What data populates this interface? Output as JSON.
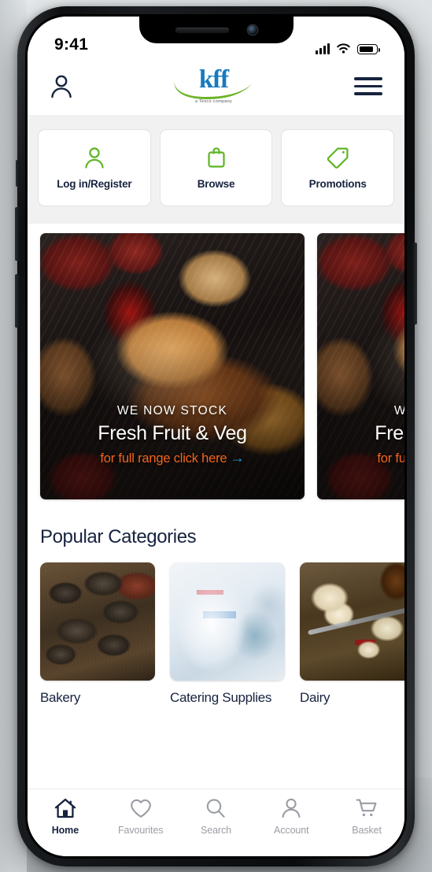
{
  "status_bar": {
    "time": "9:41",
    "signal_icon": "cellular-signal-icon",
    "wifi_icon": "wifi-icon",
    "battery_icon": "battery-icon"
  },
  "header": {
    "account_icon": "person-icon",
    "logo_text": "kff",
    "logo_tagline": "a Tesco company",
    "menu_icon": "hamburger-menu-icon",
    "logo_blue": "#1879bf",
    "logo_green": "#6cb427"
  },
  "quick_actions": [
    {
      "label": "Log in/Register",
      "icon": "person-icon"
    },
    {
      "label": "Browse",
      "icon": "shopping-bag-icon"
    },
    {
      "label": "Promotions",
      "icon": "tag-icon"
    }
  ],
  "banner": {
    "slides": [
      {
        "kicker": "WE NOW STOCK",
        "title": "Fresh Fruit & Veg",
        "cta": "for full range click here",
        "cta_arrow": "→",
        "image": "grilled-kebabs-flatbread-photo"
      },
      {
        "kicker": "WE NOW STOCK",
        "title": "Fresh Fruit & Veg",
        "cta": "for full range click here",
        "cta_arrow": "→",
        "image": "grilled-kebabs-flatbread-photo"
      }
    ],
    "cta_color": "#f4641f",
    "arrow_color": "#1f9fe0"
  },
  "categories": {
    "heading": "Popular Categories",
    "items": [
      {
        "label": "Bakery",
        "image": "bakery-pastries-photo"
      },
      {
        "label": "Catering Supplies",
        "image": "spray-bottle-photo"
      },
      {
        "label": "Dairy",
        "image": "cheese-board-photo"
      }
    ]
  },
  "tabbar": {
    "active_color": "#17233f",
    "inactive_color": "#9a9da3",
    "items": [
      {
        "label": "Home",
        "icon": "home-icon",
        "active": true
      },
      {
        "label": "Favourites",
        "icon": "heart-icon",
        "active": false
      },
      {
        "label": "Search",
        "icon": "search-icon",
        "active": false
      },
      {
        "label": "Account",
        "icon": "person-icon",
        "active": false
      },
      {
        "label": "Basket",
        "icon": "shopping-cart-icon",
        "active": false
      }
    ]
  }
}
